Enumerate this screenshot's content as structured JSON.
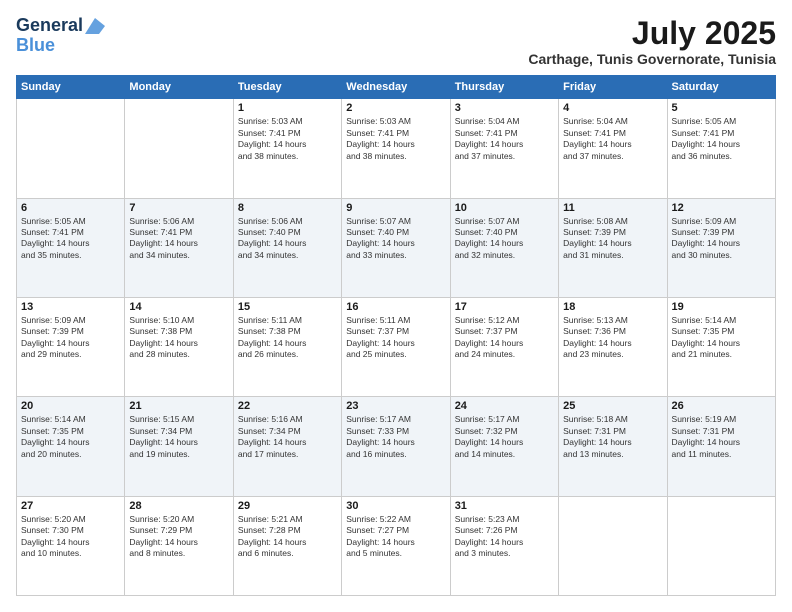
{
  "logo": {
    "line1": "General",
    "line2": "Blue"
  },
  "title": {
    "month_year": "July 2025",
    "location": "Carthage, Tunis Governorate, Tunisia"
  },
  "headers": [
    "Sunday",
    "Monday",
    "Tuesday",
    "Wednesday",
    "Thursday",
    "Friday",
    "Saturday"
  ],
  "weeks": [
    [
      {
        "day": "",
        "info": ""
      },
      {
        "day": "",
        "info": ""
      },
      {
        "day": "1",
        "info": "Sunrise: 5:03 AM\nSunset: 7:41 PM\nDaylight: 14 hours\nand 38 minutes."
      },
      {
        "day": "2",
        "info": "Sunrise: 5:03 AM\nSunset: 7:41 PM\nDaylight: 14 hours\nand 38 minutes."
      },
      {
        "day": "3",
        "info": "Sunrise: 5:04 AM\nSunset: 7:41 PM\nDaylight: 14 hours\nand 37 minutes."
      },
      {
        "day": "4",
        "info": "Sunrise: 5:04 AM\nSunset: 7:41 PM\nDaylight: 14 hours\nand 37 minutes."
      },
      {
        "day": "5",
        "info": "Sunrise: 5:05 AM\nSunset: 7:41 PM\nDaylight: 14 hours\nand 36 minutes."
      }
    ],
    [
      {
        "day": "6",
        "info": "Sunrise: 5:05 AM\nSunset: 7:41 PM\nDaylight: 14 hours\nand 35 minutes."
      },
      {
        "day": "7",
        "info": "Sunrise: 5:06 AM\nSunset: 7:41 PM\nDaylight: 14 hours\nand 34 minutes."
      },
      {
        "day": "8",
        "info": "Sunrise: 5:06 AM\nSunset: 7:40 PM\nDaylight: 14 hours\nand 34 minutes."
      },
      {
        "day": "9",
        "info": "Sunrise: 5:07 AM\nSunset: 7:40 PM\nDaylight: 14 hours\nand 33 minutes."
      },
      {
        "day": "10",
        "info": "Sunrise: 5:07 AM\nSunset: 7:40 PM\nDaylight: 14 hours\nand 32 minutes."
      },
      {
        "day": "11",
        "info": "Sunrise: 5:08 AM\nSunset: 7:39 PM\nDaylight: 14 hours\nand 31 minutes."
      },
      {
        "day": "12",
        "info": "Sunrise: 5:09 AM\nSunset: 7:39 PM\nDaylight: 14 hours\nand 30 minutes."
      }
    ],
    [
      {
        "day": "13",
        "info": "Sunrise: 5:09 AM\nSunset: 7:39 PM\nDaylight: 14 hours\nand 29 minutes."
      },
      {
        "day": "14",
        "info": "Sunrise: 5:10 AM\nSunset: 7:38 PM\nDaylight: 14 hours\nand 28 minutes."
      },
      {
        "day": "15",
        "info": "Sunrise: 5:11 AM\nSunset: 7:38 PM\nDaylight: 14 hours\nand 26 minutes."
      },
      {
        "day": "16",
        "info": "Sunrise: 5:11 AM\nSunset: 7:37 PM\nDaylight: 14 hours\nand 25 minutes."
      },
      {
        "day": "17",
        "info": "Sunrise: 5:12 AM\nSunset: 7:37 PM\nDaylight: 14 hours\nand 24 minutes."
      },
      {
        "day": "18",
        "info": "Sunrise: 5:13 AM\nSunset: 7:36 PM\nDaylight: 14 hours\nand 23 minutes."
      },
      {
        "day": "19",
        "info": "Sunrise: 5:14 AM\nSunset: 7:35 PM\nDaylight: 14 hours\nand 21 minutes."
      }
    ],
    [
      {
        "day": "20",
        "info": "Sunrise: 5:14 AM\nSunset: 7:35 PM\nDaylight: 14 hours\nand 20 minutes."
      },
      {
        "day": "21",
        "info": "Sunrise: 5:15 AM\nSunset: 7:34 PM\nDaylight: 14 hours\nand 19 minutes."
      },
      {
        "day": "22",
        "info": "Sunrise: 5:16 AM\nSunset: 7:34 PM\nDaylight: 14 hours\nand 17 minutes."
      },
      {
        "day": "23",
        "info": "Sunrise: 5:17 AM\nSunset: 7:33 PM\nDaylight: 14 hours\nand 16 minutes."
      },
      {
        "day": "24",
        "info": "Sunrise: 5:17 AM\nSunset: 7:32 PM\nDaylight: 14 hours\nand 14 minutes."
      },
      {
        "day": "25",
        "info": "Sunrise: 5:18 AM\nSunset: 7:31 PM\nDaylight: 14 hours\nand 13 minutes."
      },
      {
        "day": "26",
        "info": "Sunrise: 5:19 AM\nSunset: 7:31 PM\nDaylight: 14 hours\nand 11 minutes."
      }
    ],
    [
      {
        "day": "27",
        "info": "Sunrise: 5:20 AM\nSunset: 7:30 PM\nDaylight: 14 hours\nand 10 minutes."
      },
      {
        "day": "28",
        "info": "Sunrise: 5:20 AM\nSunset: 7:29 PM\nDaylight: 14 hours\nand 8 minutes."
      },
      {
        "day": "29",
        "info": "Sunrise: 5:21 AM\nSunset: 7:28 PM\nDaylight: 14 hours\nand 6 minutes."
      },
      {
        "day": "30",
        "info": "Sunrise: 5:22 AM\nSunset: 7:27 PM\nDaylight: 14 hours\nand 5 minutes."
      },
      {
        "day": "31",
        "info": "Sunrise: 5:23 AM\nSunset: 7:26 PM\nDaylight: 14 hours\nand 3 minutes."
      },
      {
        "day": "",
        "info": ""
      },
      {
        "day": "",
        "info": ""
      }
    ]
  ]
}
